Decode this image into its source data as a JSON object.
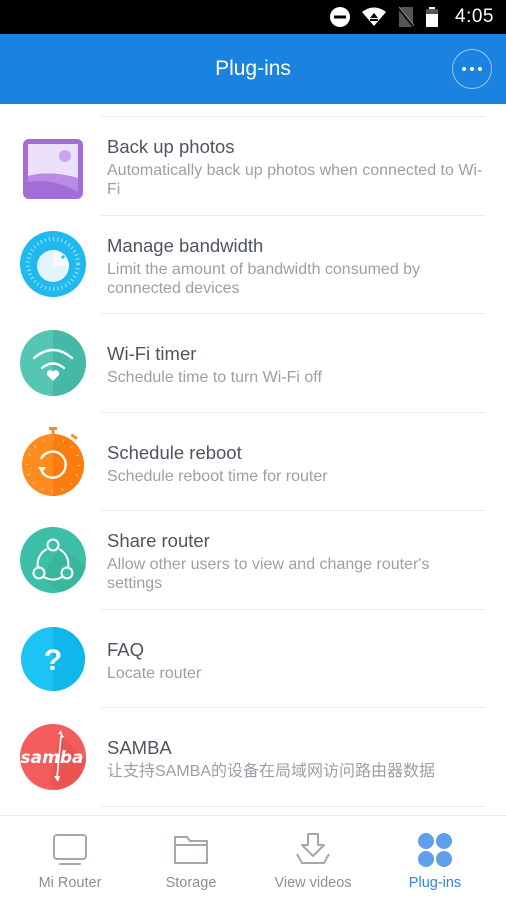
{
  "status_bar": {
    "time": "4:05",
    "icons": [
      "do-not-disturb-icon",
      "wifi-icon",
      "no-sim-icon",
      "battery-icon"
    ]
  },
  "app_bar": {
    "title": "Plug-ins",
    "more_button_icon": "more-horizontal-icon"
  },
  "colors": {
    "primary": "#1a82e0",
    "active_tab": "#2d87e4",
    "inactive_tab": "#8a9097",
    "title_text": "#4e5560",
    "desc_text": "#9aa0a8"
  },
  "plugins": [
    {
      "title": "Back up photos",
      "description": "Automatically back up photos when connected to Wi-Fi",
      "icon": "photo-backup-icon",
      "color": "#a36dd6"
    },
    {
      "title": "Manage bandwidth",
      "description": "Limit the amount of bandwidth consumed by connected devices",
      "icon": "bandwidth-dial-icon",
      "color": "#1fb9ee"
    },
    {
      "title": "Wi-Fi timer",
      "description": "Schedule time to turn Wi-Fi off",
      "icon": "wifi-timer-icon",
      "color": "#4fc3b0"
    },
    {
      "title": "Schedule reboot",
      "description": "Schedule reboot time for router",
      "icon": "reboot-timer-icon",
      "color": "#ff8a1e"
    },
    {
      "title": "Share router",
      "description": "Allow other users to view and change router's settings",
      "icon": "share-icon",
      "color": "#3cbfa6"
    },
    {
      "title": "FAQ",
      "description": "Locate router",
      "icon": "question-icon",
      "color": "#1ec3f5"
    },
    {
      "title": "SAMBA",
      "description": "让支持SAMBA的设备在局域网访问路由器数据",
      "icon": "samba-icon",
      "color": "#f45d5d"
    }
  ],
  "bottom_nav": [
    {
      "label": "Mi Router",
      "icon": "monitor-icon",
      "active": false
    },
    {
      "label": "Storage",
      "icon": "folder-icon",
      "active": false
    },
    {
      "label": "View videos",
      "icon": "download-icon",
      "active": false
    },
    {
      "label": "Plug-ins",
      "icon": "grid-dots-icon",
      "active": true
    }
  ]
}
